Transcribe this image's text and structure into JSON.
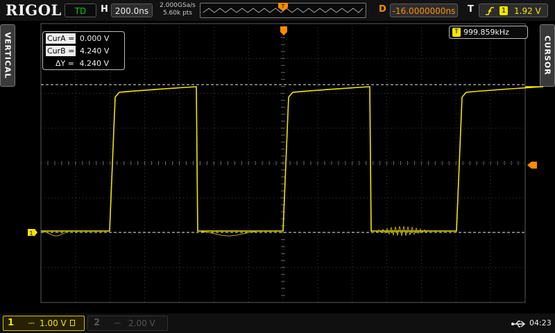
{
  "brand": "RIGOL",
  "status": "TD",
  "horizontal": {
    "label": "H",
    "timebase": "200.0ns"
  },
  "sampling": {
    "rate": "2.000GSa/s",
    "points": "5.60k pts"
  },
  "delay": {
    "label": "D",
    "value": "-16.0000000ns"
  },
  "trigger": {
    "label": "T",
    "source": "1",
    "level": "1.92 V"
  },
  "side_tabs": {
    "left": "VERTICAL",
    "right": "CURSOR"
  },
  "cursor": {
    "cur_a_label": "CurA =",
    "cur_a_value": "0.000 V",
    "cur_b_label": "CurB =",
    "cur_b_value": "4.240 V",
    "delta_label": "ΔY =",
    "delta_value": "4.240 V"
  },
  "frequency": {
    "source": "T",
    "value": "999.859kHz"
  },
  "channels": [
    {
      "number": "1",
      "coupling": "⎓",
      "scale": "1.00 V",
      "active": true,
      "color": "#f2e600"
    },
    {
      "number": "2",
      "coupling": "⎓",
      "scale": "2.00 V",
      "active": false,
      "color": "#555555"
    }
  ],
  "clock": "04:23",
  "colors": {
    "trace": "#f2e600",
    "delay": "#ff8c00",
    "status": "#00d000",
    "grid": "#5a5a5a"
  }
}
